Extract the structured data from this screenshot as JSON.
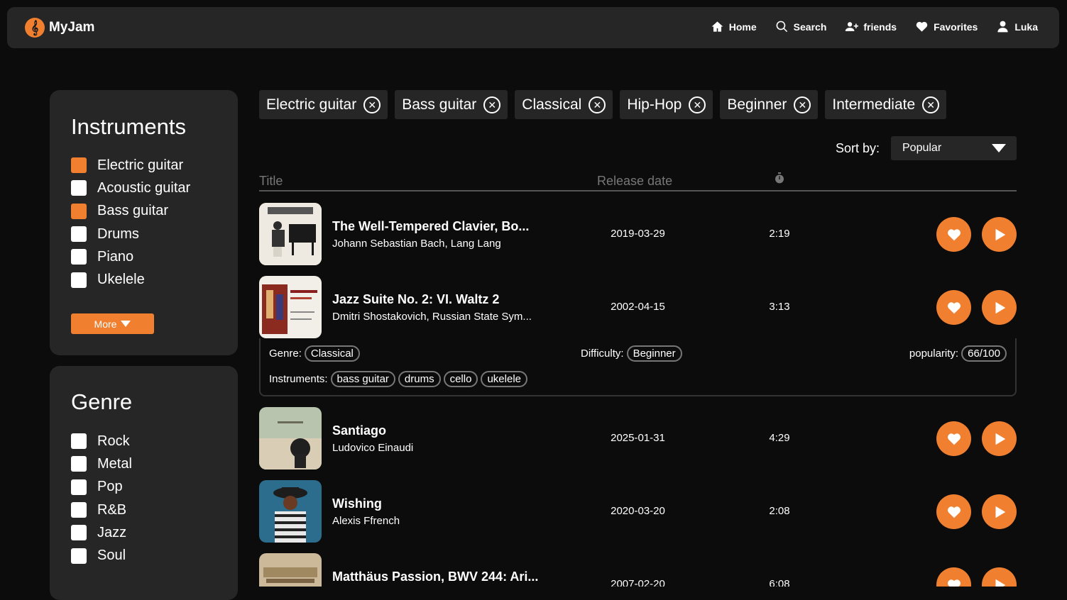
{
  "app": {
    "name": "MyJam",
    "accent": "#f08030"
  },
  "nav": [
    {
      "label": "Home",
      "icon": "home-icon"
    },
    {
      "label": "Search",
      "icon": "search-icon"
    },
    {
      "label": "friends",
      "icon": "add-friend-icon"
    },
    {
      "label": "Favorites",
      "icon": "heart-icon"
    },
    {
      "label": "Luka",
      "icon": "user-icon"
    }
  ],
  "instruments": {
    "title": "Instruments",
    "items": [
      {
        "label": "Electric guitar",
        "checked": true
      },
      {
        "label": "Acoustic guitar",
        "checked": false
      },
      {
        "label": "Bass guitar",
        "checked": true
      },
      {
        "label": "Drums",
        "checked": false
      },
      {
        "label": "Piano",
        "checked": false
      },
      {
        "label": "Ukelele",
        "checked": false
      }
    ],
    "more_label": "More"
  },
  "genre": {
    "title": "Genre",
    "items": [
      {
        "label": "Rock",
        "checked": false
      },
      {
        "label": "Metal",
        "checked": false
      },
      {
        "label": "Pop",
        "checked": false
      },
      {
        "label": "R&B",
        "checked": false
      },
      {
        "label": "Jazz",
        "checked": false
      },
      {
        "label": "Soul",
        "checked": false
      }
    ]
  },
  "filters": [
    "Electric guitar",
    "Bass guitar",
    "Classical",
    "Hip-Hop",
    "Beginner",
    "Intermediate"
  ],
  "sort": {
    "label": "Sort by:",
    "value": "Popular"
  },
  "table": {
    "col_title": "Title",
    "col_date": "Release date",
    "col_duration_icon": "stopwatch-icon"
  },
  "songs": [
    {
      "title": "The Well-Tempered Clavier, Bo...",
      "artist": "Johann Sebastian Bach, Lang Lang",
      "date": "2019-03-29",
      "duration": "2:19",
      "cover": "#e8e4dc"
    },
    {
      "title": "Jazz Suite No. 2: VI. Waltz 2",
      "artist": "Dmitri Shostakovich, Russian State Sym...",
      "date": "2002-04-15",
      "duration": "3:13",
      "cover": "#c9c3b5"
    },
    {
      "title": "Santiago",
      "artist": "Ludovico Einaudi",
      "date": "2025-01-31",
      "duration": "4:29",
      "cover": "#a9b9a4"
    },
    {
      "title": "Wishing",
      "artist": "Alexis Ffrench",
      "date": "2020-03-20",
      "duration": "2:08",
      "cover": "#2f6f8f"
    },
    {
      "title": "Matthäus Passion, BWV 244: Ari...",
      "artist": "",
      "date": "2007-02-20",
      "duration": "6:08",
      "cover": "#c9b79a"
    }
  ],
  "details": {
    "genre_label": "Genre:",
    "genre": "Classical",
    "difficulty_label": "Difficulty:",
    "difficulty": "Beginner",
    "popularity_label": "popularity:",
    "popularity": "66/100",
    "instruments_label": "Instruments:",
    "instruments": [
      "bass guitar",
      "drums",
      "cello",
      "ukelele"
    ]
  }
}
